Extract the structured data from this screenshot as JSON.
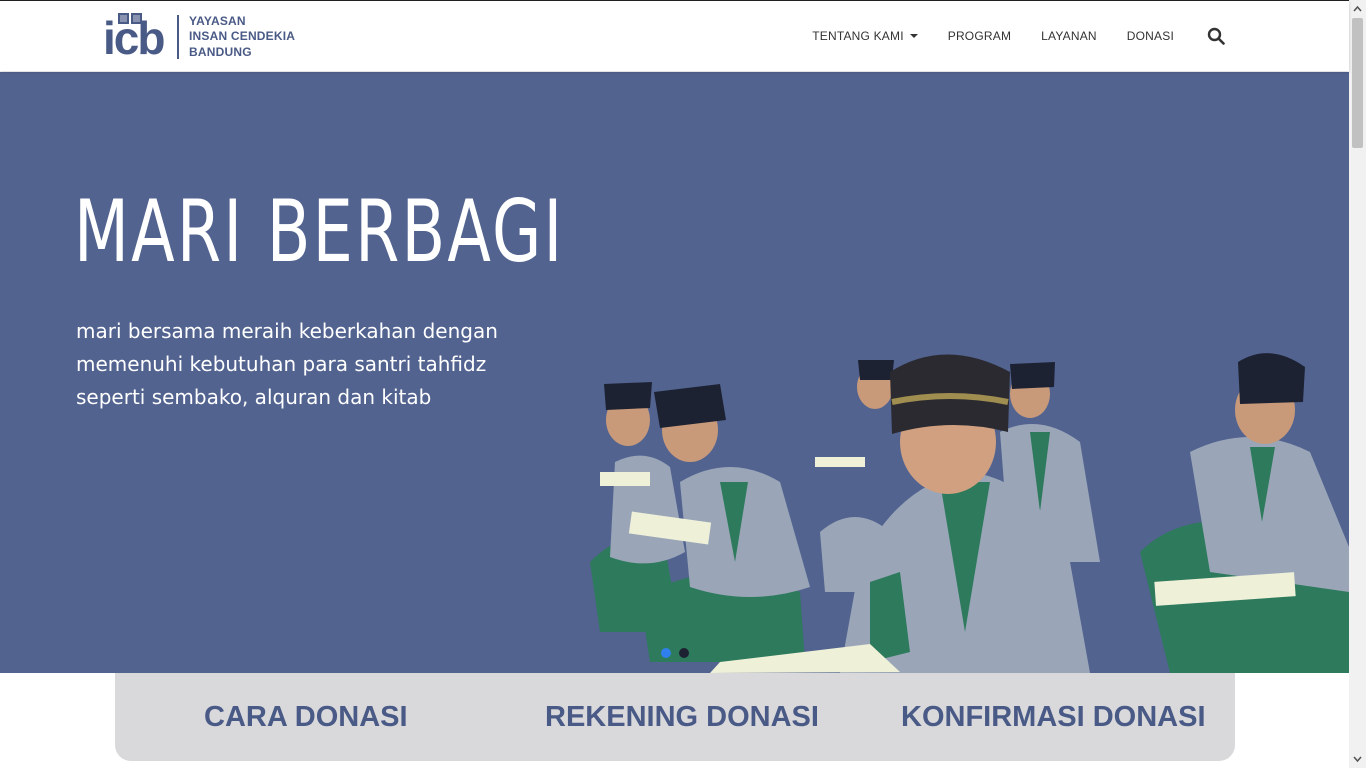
{
  "logo": {
    "mark": "icb",
    "line1": "YAYASAN",
    "line2": "INSAN CENDEKIA",
    "line3": "BANDUNG"
  },
  "nav": {
    "items": [
      "TENTANG KAMI",
      "PROGRAM",
      "LAYANAN",
      "DONASI"
    ],
    "search_icon": "search-icon"
  },
  "hero": {
    "title": "MARI BERBAGI",
    "subtitle_lines": [
      "mari bersama meraih keberkahan dengan",
      "memenuhi kebutuhan para  santri tahfidz",
      "seperti sembako, alquran dan kitab"
    ],
    "slides_total": 2,
    "active_slide": 1
  },
  "donate": {
    "links": [
      "CARA DONASI",
      "REKENING DONASI",
      "KONFIRMASI DONASI"
    ]
  },
  "colors": {
    "hero_bg": "#526390",
    "brand": "#4a5a86",
    "dot_active": "#2f80ed",
    "dot_inactive": "#1d2232"
  }
}
